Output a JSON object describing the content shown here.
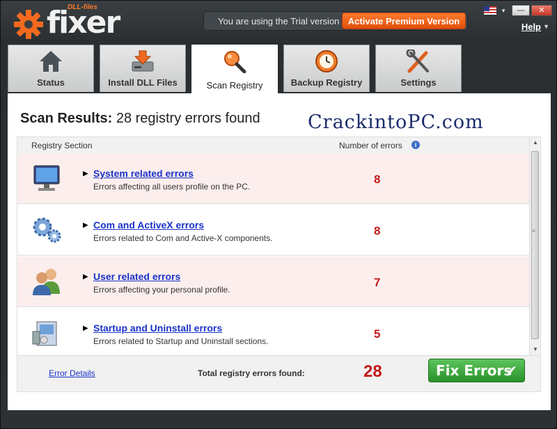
{
  "app": {
    "logo_text": "fixer",
    "logo_sub": "DLL-files"
  },
  "header": {
    "trial_text": "You are using the Trial version",
    "activate_label": "Activate Premium Version",
    "help_label": "Help",
    "window_controls": {
      "minimize": "—",
      "maximize": "□",
      "close": "✕"
    }
  },
  "tabs": [
    {
      "label": "Status",
      "icon": "home-icon"
    },
    {
      "label": "Install DLL Files",
      "icon": "download-drive-icon"
    },
    {
      "label": "Scan Registry",
      "icon": "magnifier-icon",
      "active": true
    },
    {
      "label": "Backup Registry",
      "icon": "clock-backup-icon"
    },
    {
      "label": "Settings",
      "icon": "tools-icon"
    }
  ],
  "scan": {
    "title_bold": "Scan Results:",
    "title_rest": " 28 registry errors found",
    "watermark": "CrackintoPC.com"
  },
  "table": {
    "col_section": "Registry Section",
    "col_count": "Number of errors",
    "rows": [
      {
        "title": "System related errors",
        "desc": "Errors affecting all users profile on the PC.",
        "count": "8",
        "icon": "monitor-icon"
      },
      {
        "title": "Com and ActiveX errors",
        "desc": "Errors related to Com and Active-X components.",
        "count": "8",
        "icon": "gears-icon"
      },
      {
        "title": "User related errors",
        "desc": "Errors affecting your personal profile.",
        "count": "7",
        "icon": "users-icon"
      },
      {
        "title": "Startup and Uninstall errors",
        "desc": "Errors related to Startup and Uninstall sections.",
        "count": "5",
        "icon": "installer-box-icon"
      }
    ]
  },
  "footer": {
    "error_details": "Error Details",
    "total_label": "Total registry errors found:",
    "total_value": "28",
    "fix_label": "Fix Errors",
    "fix_check": "✔"
  },
  "colors": {
    "accent_orange": "#e8581a",
    "error_red": "#c41a1a",
    "link_blue": "#1a33c8",
    "fix_green": "#2e9a2e",
    "row_pink": "#fdeeee"
  }
}
